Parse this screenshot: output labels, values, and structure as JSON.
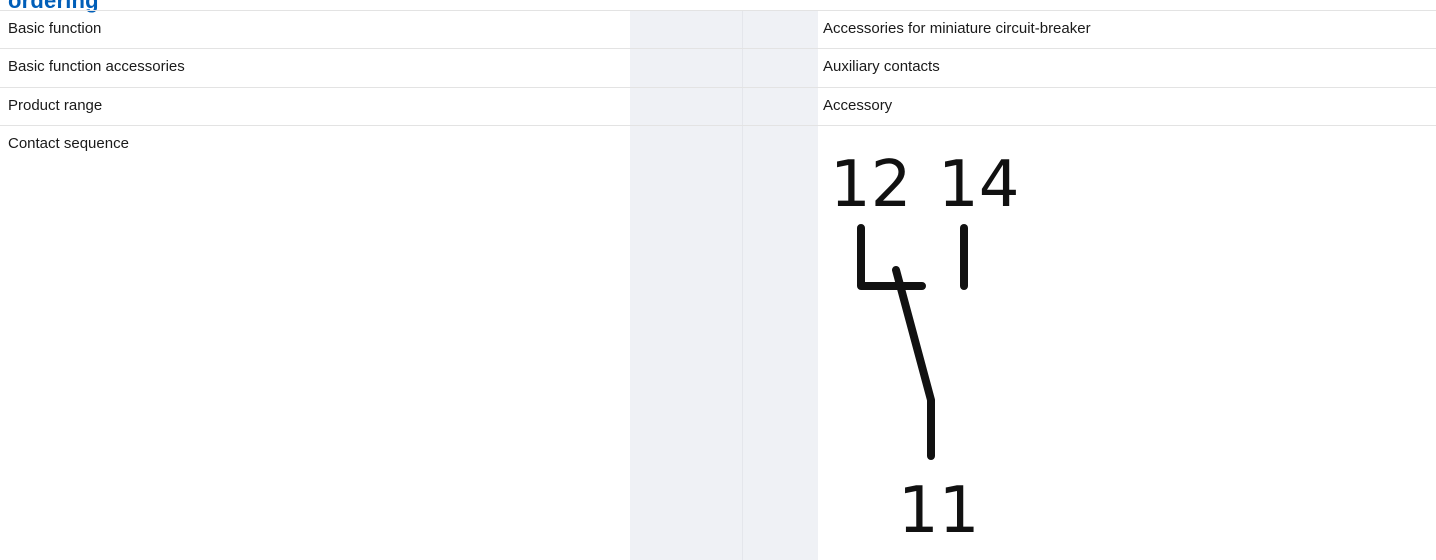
{
  "section": {
    "title": "ordering"
  },
  "rows": [
    {
      "label": "Basic function",
      "value": "Accessories for miniature circuit-breaker"
    },
    {
      "label": "Basic function accessories",
      "value": "Auxiliary contacts"
    },
    {
      "label": "Product range",
      "value": "Accessory"
    },
    {
      "label": "Contact sequence",
      "value": ""
    }
  ],
  "contact_diagram": {
    "terminal_nc": "12",
    "terminal_no": "14",
    "terminal_common": "11"
  }
}
